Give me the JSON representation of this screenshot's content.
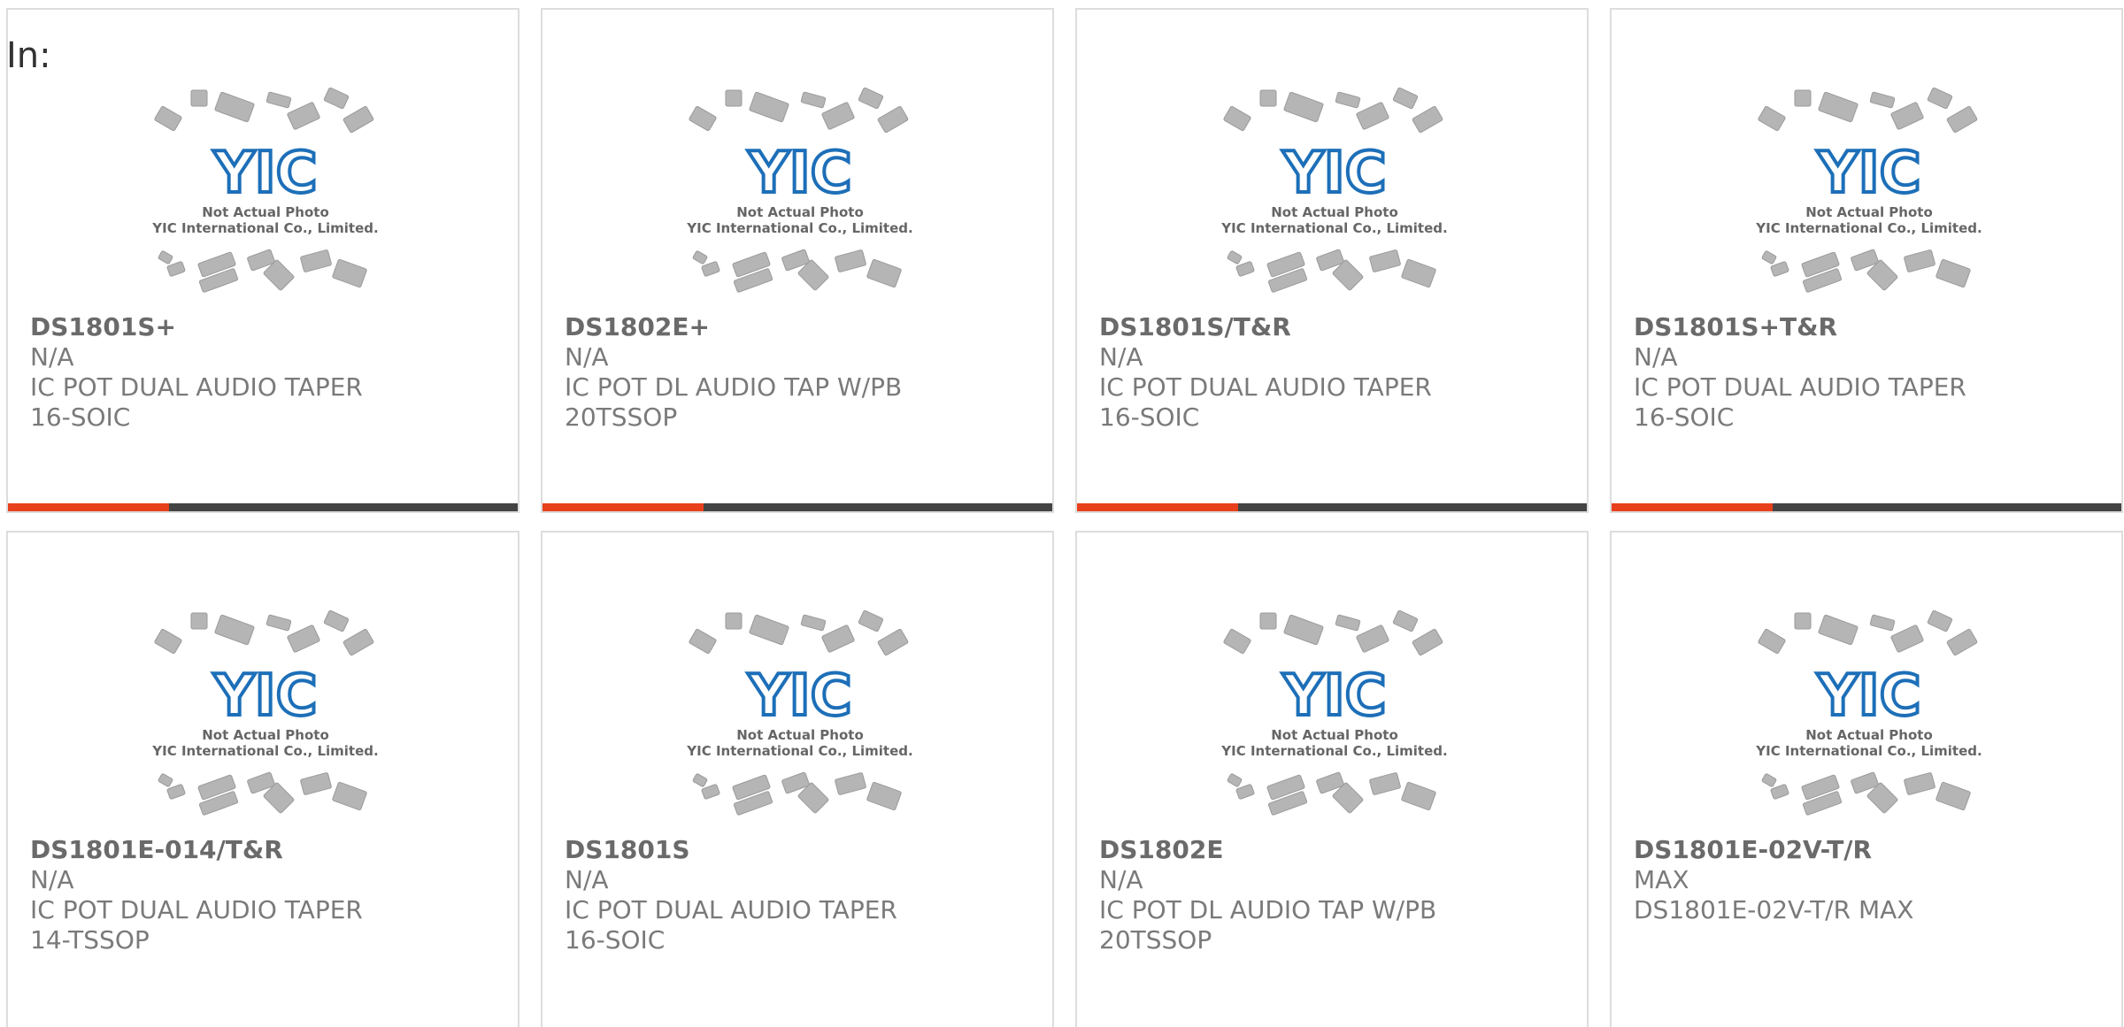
{
  "page": {
    "in_label": "In:"
  },
  "photo": {
    "logo_text": "YIC",
    "line1": "Not Actual Photo",
    "line2": "YIC International Co., Limited."
  },
  "products": [
    {
      "part": "DS1801S+",
      "mfr": "N/A",
      "desc": "IC POT DUAL AUDIO TAPER 16-SOIC"
    },
    {
      "part": "DS1802E+",
      "mfr": "N/A",
      "desc": "IC POT DL AUDIO TAP W/PB 20TSSOP"
    },
    {
      "part": "DS1801S/T&R",
      "mfr": "N/A",
      "desc": "IC POT DUAL AUDIO TAPER 16-SOIC"
    },
    {
      "part": "DS1801S+T&R",
      "mfr": "N/A",
      "desc": "IC POT DUAL AUDIO TAPER 16-SOIC"
    },
    {
      "part": "DS1801E-014/T&R",
      "mfr": "N/A",
      "desc": "IC POT DUAL AUDIO TAPER 14-TSSOP"
    },
    {
      "part": "DS1801S",
      "mfr": "N/A",
      "desc": "IC POT DUAL AUDIO TAPER 16-SOIC"
    },
    {
      "part": "DS1802E",
      "mfr": "N/A",
      "desc": "IC POT DL AUDIO TAP W/PB 20TSSOP"
    },
    {
      "part": "DS1801E-02V-T/R",
      "mfr": "MAX",
      "desc": "DS1801E-02V-T/R MAX"
    }
  ],
  "colors": {
    "accent_red": "#e8401c",
    "accent_dark": "#444444",
    "logo_blue": "#1d6fb8",
    "chip_gray": "#b5b5b5"
  },
  "icons": {
    "product_photo": "ic-chip-placeholder-icon"
  }
}
